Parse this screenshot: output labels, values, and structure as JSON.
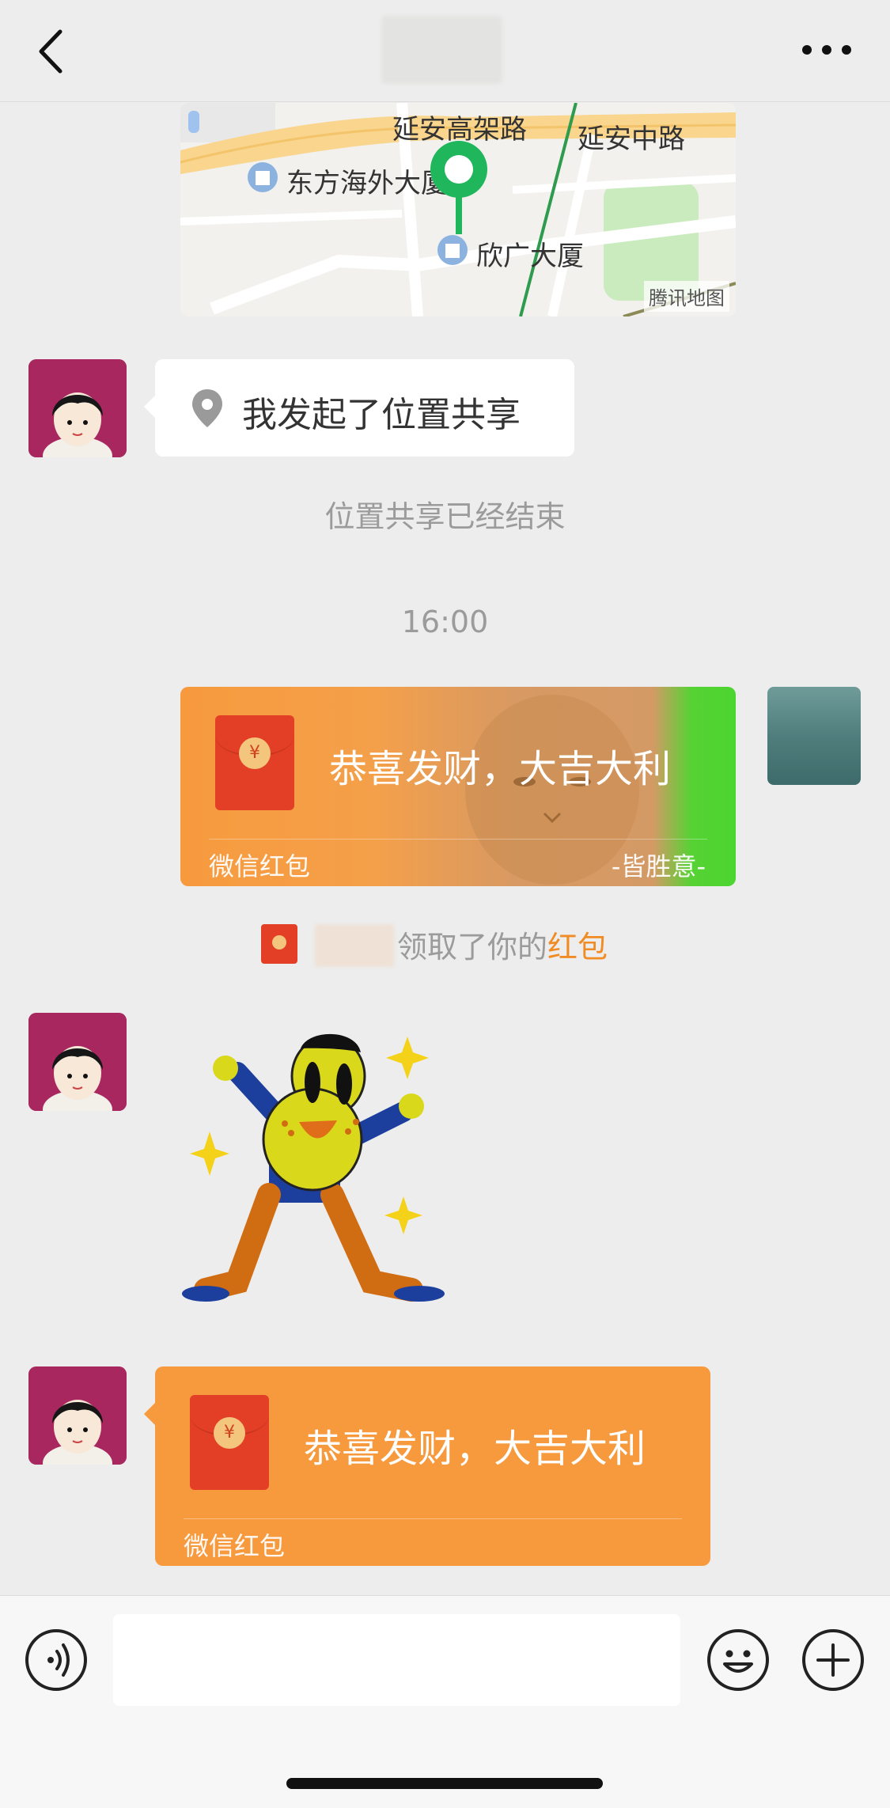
{
  "nav": {
    "back_icon": "chevron-left-icon",
    "more_icon": "more-horizontal-icon"
  },
  "map": {
    "roads": [
      "延安高架路",
      "延安中路"
    ],
    "pois": [
      "东方海外大厦",
      "欣广大厦"
    ],
    "attribution": "腾讯地图",
    "pin_color": "#20b75c"
  },
  "location_share": {
    "text": "我发起了位置共享",
    "icon": "location-pin-icon"
  },
  "system_ended": "位置共享已经结束",
  "timestamp": "16:00",
  "sent_red_packet": {
    "title": "恭喜发财，大吉大利",
    "footer_left": "微信红包",
    "footer_right": "-皆胜意-",
    "color": "#f79a3e"
  },
  "received_notice": {
    "text": "领取了你的",
    "link": "红包",
    "link_color": "#f08c23"
  },
  "received_red_packet": {
    "title": "恭喜发财，大吉大利",
    "footer_left": "微信红包",
    "color": "#f79a3e"
  },
  "input_bar": {
    "voice_icon": "voice-icon",
    "emoji_icon": "emoji-icon",
    "plus_icon": "plus-icon",
    "placeholder": ""
  }
}
